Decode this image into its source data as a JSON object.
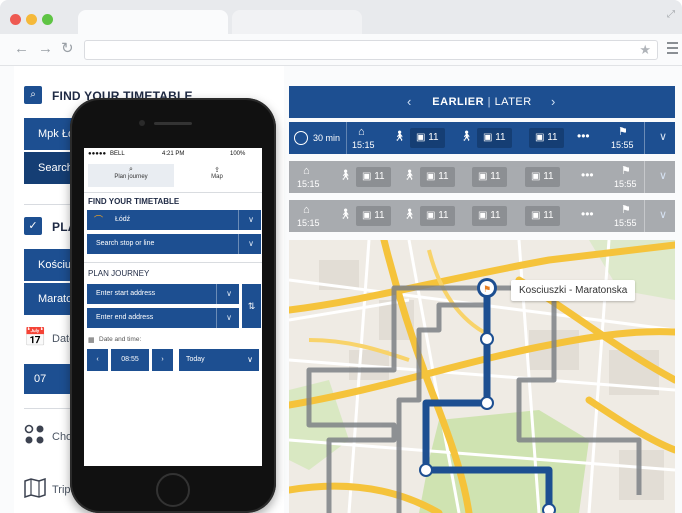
{
  "left_panel": {
    "timetable_heading": "FIND YOUR TIMETABLE",
    "city_value": "Mpk Łó",
    "search_value": "Search",
    "plan_heading": "PLA",
    "start_value": "Kościus",
    "end_value": "Marato",
    "date_label": "Date",
    "date_value": "07",
    "choose_label": "Cho",
    "trip_label": "Trip"
  },
  "timetable": {
    "earlier_label": "EARLIER",
    "later_label": "LATER",
    "trips": [
      {
        "duration": "30 min",
        "start_time": "15:15",
        "bus1": "11",
        "bus2": "11",
        "bus3": "11",
        "end_time": "15:55"
      },
      {
        "start_time": "15:15",
        "bus1": "11",
        "bus2": "11",
        "bus3": "11",
        "bus4": "11",
        "end_time": "15:55"
      },
      {
        "start_time": "15:15",
        "bus1": "11",
        "bus2": "11",
        "bus3": "11",
        "bus4": "11",
        "end_time": "15:55"
      }
    ]
  },
  "map": {
    "stop_label": "Kosciuszki - Maratonska"
  },
  "phone": {
    "status": {
      "carrier": "BELL",
      "time": "4:21 PM",
      "battery": "100%"
    },
    "tabs": [
      "Plan journey",
      "Map"
    ],
    "timetable_heading": "FIND YOUR TIMETABLE",
    "city": "Łódź",
    "search_placeholder": "Search stop or line",
    "plan_heading": "PLAN JOURNEY",
    "start_placeholder": "Enter start address",
    "end_placeholder": "Enter end address",
    "date_label": "Date and time:",
    "time_value": "08:55",
    "day_value": "Today"
  },
  "colors": {
    "primary": "#1d4f91",
    "gray_row": "#a8abaf",
    "road_yellow": "#f5c33b",
    "park_green": "#cfe3b1"
  }
}
